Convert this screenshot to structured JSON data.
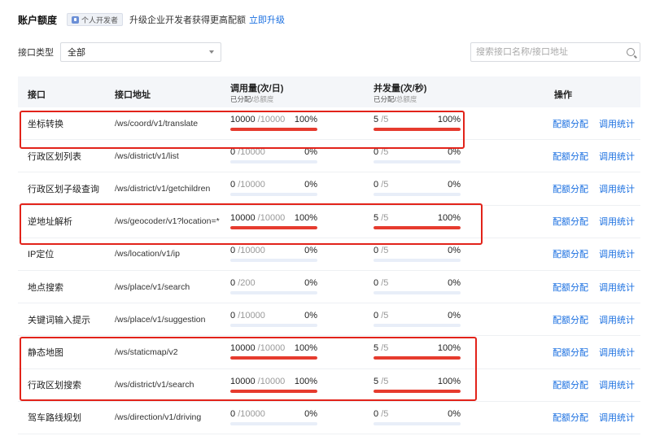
{
  "header": {
    "title": "账户额度",
    "badge": "个人开发者",
    "upgrade_text": "升级企业开发者获得更高配额",
    "upgrade_link": "立即升级"
  },
  "filter": {
    "label": "接口类型",
    "selected": "全部"
  },
  "search": {
    "placeholder": "搜索接口名称/接口地址"
  },
  "table": {
    "columns": {
      "name": "接口",
      "path": "接口地址",
      "calls": "调用量(次/日)",
      "calls_sub_a": "已分配/",
      "calls_sub_b": "总额度",
      "concurrency": "并发量(次/秒)",
      "conc_sub_a": "已分配/",
      "conc_sub_b": "总额度",
      "ops": "操作"
    },
    "rows": [
      {
        "name": "坐标转换",
        "path": "/ws/coord/v1/translate",
        "calls_used": "10000",
        "calls_total": "/10000",
        "calls_pct": "100%",
        "calls_fill": 1.0,
        "conc_used": "5",
        "conc_total": "/5",
        "conc_pct": "100%",
        "conc_fill": 1.0,
        "op1": "配额分配",
        "op2": "调用统计"
      },
      {
        "name": "行政区划列表",
        "path": "/ws/district/v1/list",
        "calls_used": "0",
        "calls_total": "/10000",
        "calls_pct": "0%",
        "calls_fill": 0,
        "conc_used": "0",
        "conc_total": "/5",
        "conc_pct": "0%",
        "conc_fill": 0,
        "op1": "配额分配",
        "op2": "调用统计"
      },
      {
        "name": "行政区划子级查询",
        "path": "/ws/district/v1/getchildren",
        "calls_used": "0",
        "calls_total": "/10000",
        "calls_pct": "0%",
        "calls_fill": 0,
        "conc_used": "0",
        "conc_total": "/5",
        "conc_pct": "0%",
        "conc_fill": 0,
        "op1": "配额分配",
        "op2": "调用统计"
      },
      {
        "name": "逆地址解析",
        "path": "/ws/geocoder/v1?location=*",
        "calls_used": "10000",
        "calls_total": "/10000",
        "calls_pct": "100%",
        "calls_fill": 1.0,
        "conc_used": "5",
        "conc_total": "/5",
        "conc_pct": "100%",
        "conc_fill": 1.0,
        "op1": "配额分配",
        "op2": "调用统计"
      },
      {
        "name": "IP定位",
        "path": "/ws/location/v1/ip",
        "calls_used": "0",
        "calls_total": "/10000",
        "calls_pct": "0%",
        "calls_fill": 0,
        "conc_used": "0",
        "conc_total": "/5",
        "conc_pct": "0%",
        "conc_fill": 0,
        "op1": "配额分配",
        "op2": "调用统计"
      },
      {
        "name": "地点搜索",
        "path": "/ws/place/v1/search",
        "calls_used": "0",
        "calls_total": "/200",
        "calls_pct": "0%",
        "calls_fill": 0,
        "conc_used": "0",
        "conc_total": "/5",
        "conc_pct": "0%",
        "conc_fill": 0,
        "op1": "配额分配",
        "op2": "调用统计"
      },
      {
        "name": "关键词输入提示",
        "path": "/ws/place/v1/suggestion",
        "calls_used": "0",
        "calls_total": "/10000",
        "calls_pct": "0%",
        "calls_fill": 0,
        "conc_used": "0",
        "conc_total": "/5",
        "conc_pct": "0%",
        "conc_fill": 0,
        "op1": "配额分配",
        "op2": "调用统计"
      },
      {
        "name": "静态地图",
        "path": "/ws/staticmap/v2",
        "calls_used": "10000",
        "calls_total": "/10000",
        "calls_pct": "100%",
        "calls_fill": 1.0,
        "conc_used": "5",
        "conc_total": "/5",
        "conc_pct": "100%",
        "conc_fill": 1.0,
        "op1": "配额分配",
        "op2": "调用统计"
      },
      {
        "name": "行政区划搜索",
        "path": "/ws/district/v1/search",
        "calls_used": "10000",
        "calls_total": "/10000",
        "calls_pct": "100%",
        "calls_fill": 1.0,
        "conc_used": "5",
        "conc_total": "/5",
        "conc_pct": "100%",
        "conc_fill": 1.0,
        "op1": "配额分配",
        "op2": "调用统计"
      },
      {
        "name": "驾车路线规划",
        "path": "/ws/direction/v1/driving",
        "calls_used": "0",
        "calls_total": "/10000",
        "calls_pct": "0%",
        "calls_fill": 0,
        "conc_used": "0",
        "conc_total": "/5",
        "conc_pct": "0%",
        "conc_fill": 0,
        "op1": "配额分配",
        "op2": "调用统计"
      }
    ]
  },
  "colors": {
    "accent": "#1a6fe0",
    "bar_fill": "#e63b2e",
    "bar_track": "#e8eef8",
    "highlight": "#e2231a"
  }
}
